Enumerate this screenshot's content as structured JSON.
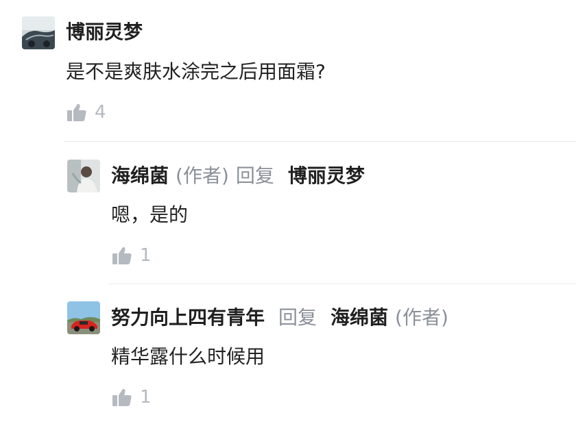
{
  "comments": [
    {
      "author": "博丽灵梦",
      "content": "是不是爽肤水涂完之后用面霜?",
      "likes": "4",
      "avatar_icon": "avatar-car-dark"
    }
  ],
  "replies": [
    {
      "author": "海绵菌",
      "author_tag": "(作者)",
      "reply_word": "回复",
      "target": "博丽灵梦",
      "target_tag": "",
      "content": "嗯，是的",
      "likes": "1",
      "avatar_icon": "avatar-person-photo"
    },
    {
      "author": "努力向上四有青年",
      "author_tag": "",
      "reply_word": "回复",
      "target": "海绵菌",
      "target_tag": "(作者)",
      "content": "精华露什么时候用",
      "likes": "1",
      "avatar_icon": "avatar-red-sports-car"
    }
  ],
  "colors": {
    "muted": "#8a8f99",
    "like": "#b5b9c0",
    "divider": "#ebebeb"
  }
}
